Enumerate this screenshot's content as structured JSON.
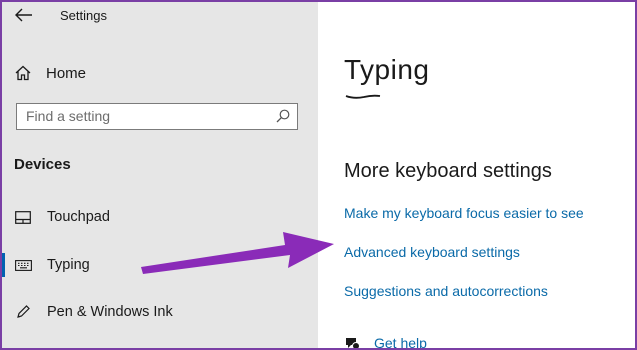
{
  "window": {
    "title": "Settings"
  },
  "sidebar": {
    "home_label": "Home",
    "search": {
      "placeholder": "Find a setting",
      "value": ""
    },
    "section_title": "Devices",
    "items": [
      {
        "label": "Touchpad",
        "icon": "touchpad-icon"
      },
      {
        "label": "Typing",
        "icon": "keyboard-icon",
        "selected": true
      },
      {
        "label": "Pen & Windows Ink",
        "icon": "pen-icon"
      }
    ]
  },
  "main": {
    "title": "Typing",
    "section_title": "More keyboard settings",
    "links": [
      "Make my keyboard focus easier to see",
      "Advanced keyboard settings",
      "Suggestions and autocorrections"
    ],
    "help_label": "Get help"
  },
  "colors": {
    "accent": "#0063b1",
    "link": "#0a6aa8",
    "annotation_arrow": "#8a2bb8",
    "frame": "#7a3fa5"
  }
}
